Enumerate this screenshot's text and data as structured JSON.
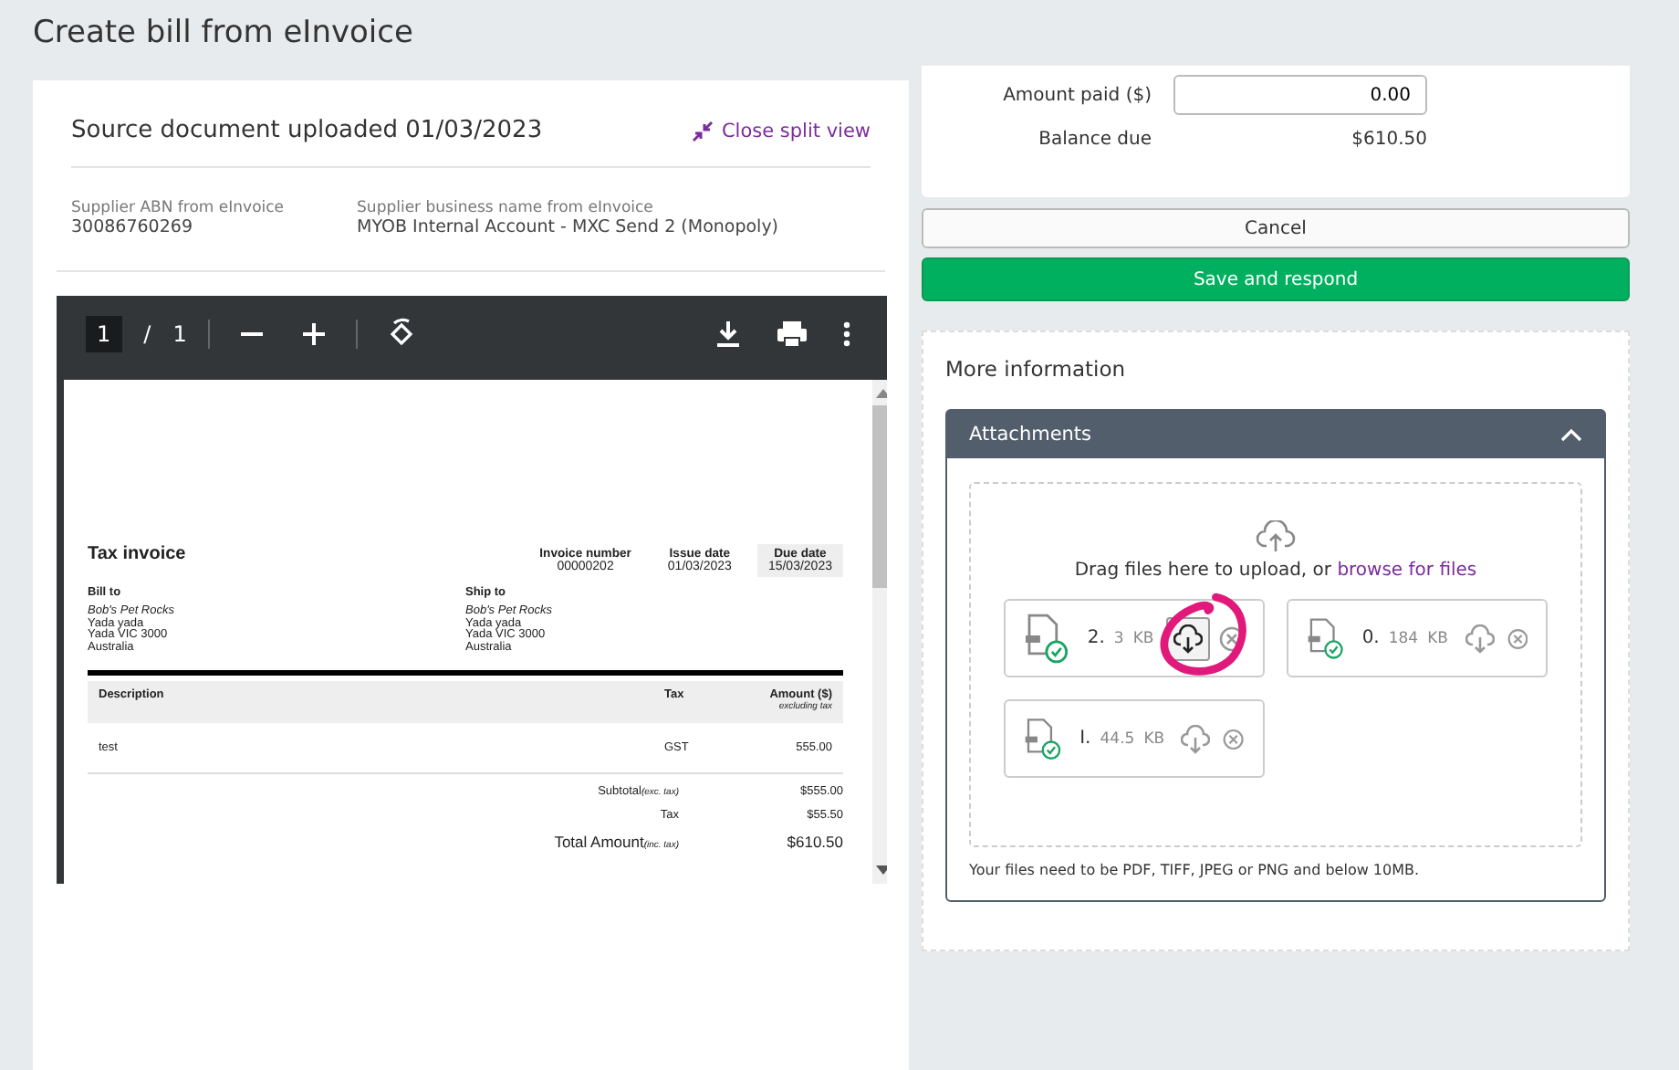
{
  "page": {
    "title": "Create bill from eInvoice"
  },
  "source": {
    "heading": "Source document uploaded 01/03/2023",
    "close_link": "Close split view",
    "fields": [
      {
        "label": "Supplier ABN from eInvoice",
        "value": "30086760269"
      },
      {
        "label": "Supplier business name from eInvoice",
        "value": "MYOB Internal Account - MXC Send 2 (Monopoly)"
      }
    ]
  },
  "pdf_viewer": {
    "page": "1",
    "separator": "/",
    "pages": "1"
  },
  "invoice": {
    "title": "Tax invoice",
    "meta": [
      {
        "label": "Invoice number",
        "value": "00000202",
        "shaded": false
      },
      {
        "label": "Issue date",
        "value": "01/03/2023",
        "shaded": false
      },
      {
        "label": "Due date",
        "value": "15/03/2023",
        "shaded": true
      }
    ],
    "bill_to": {
      "heading": "Bill to",
      "lines": [
        "Bob's Pet Rocks",
        "Yada yada",
        "Yada VIC 3000",
        "Australia"
      ]
    },
    "ship_to": {
      "heading": "Ship to",
      "lines": [
        "Bob's Pet Rocks",
        "Yada yada",
        "Yada VIC 3000",
        "Australia"
      ]
    },
    "columns": [
      "Description",
      "Tax",
      "Amount ($)"
    ],
    "amount_note": "excluding tax",
    "rows": [
      {
        "description": "test",
        "tax": "GST",
        "amount": "555.00"
      }
    ],
    "totals": [
      {
        "label": "Subtotal",
        "note": "(exc. tax)",
        "value": "$555.00",
        "kind": "normal"
      },
      {
        "label": "Tax",
        "value": "$55.50",
        "kind": "normal"
      },
      {
        "label": "Total Amount",
        "note": "(inc. tax)",
        "value": "$610.50",
        "kind": "grand"
      }
    ]
  },
  "payment": {
    "amount_paid_label": "Amount paid ($)",
    "amount_paid": "0.00",
    "balance_label": "Balance due",
    "balance": "$610.50"
  },
  "buttons": [
    {
      "label": "Cancel",
      "kind": "secondary"
    },
    {
      "label": "Save and respond",
      "kind": "primary"
    }
  ],
  "more_info": {
    "heading": "More information",
    "attachments": {
      "title": "Attachments",
      "expanded": true,
      "drop_text": "Drag files here to upload, or",
      "browse_link": "browse for files",
      "files": [
        {
          "name": "2.",
          "size": "3",
          "unit": "KB",
          "highlighted": true
        },
        {
          "name": "0.",
          "size": "184",
          "unit": "KB",
          "highlighted": false
        },
        {
          "name": "I.",
          "size": "44.5",
          "unit": "KB",
          "highlighted": false
        }
      ],
      "note": "Your files need to be PDF, TIFF, JPEG or PNG and below 10MB."
    }
  }
}
